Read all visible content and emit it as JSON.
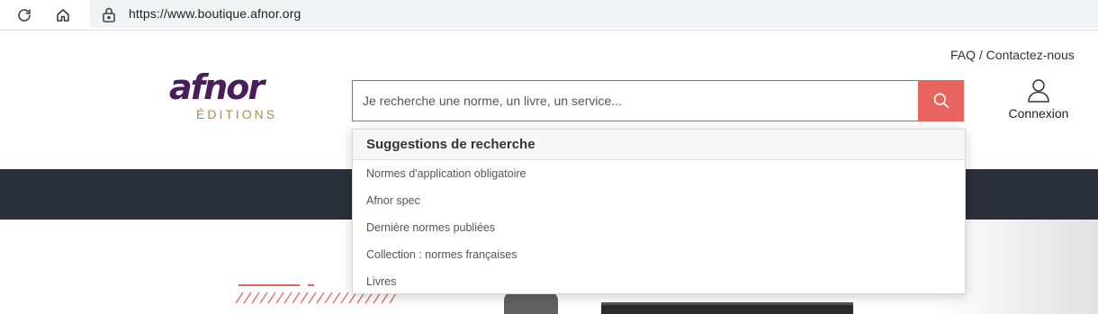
{
  "browser": {
    "url": "https://www.boutique.afnor.org"
  },
  "header": {
    "top_link": "FAQ / Contactez-nous",
    "logo_text": "afnor",
    "logo_sub": "ÉDITIONS",
    "search_placeholder": "Je recherche une norme, un livre, un service...",
    "search_value": "",
    "account_label": "Connexion"
  },
  "suggestions": {
    "title": "Suggestions de recherche",
    "items": [
      "Normes d'application obligatoire",
      "Afnor spec",
      "Dernière normes publiées",
      "Collection : normes françaises",
      "Livres"
    ]
  },
  "colors": {
    "accent": "#e8645f",
    "nav_band": "#2a2f3a",
    "logo_purple": "#4a1d5c",
    "logo_gold": "#b48a48"
  },
  "icons": {
    "reload": "reload-icon",
    "home": "home-icon",
    "lock": "lock-icon",
    "search": "search-icon",
    "user": "user-icon"
  }
}
